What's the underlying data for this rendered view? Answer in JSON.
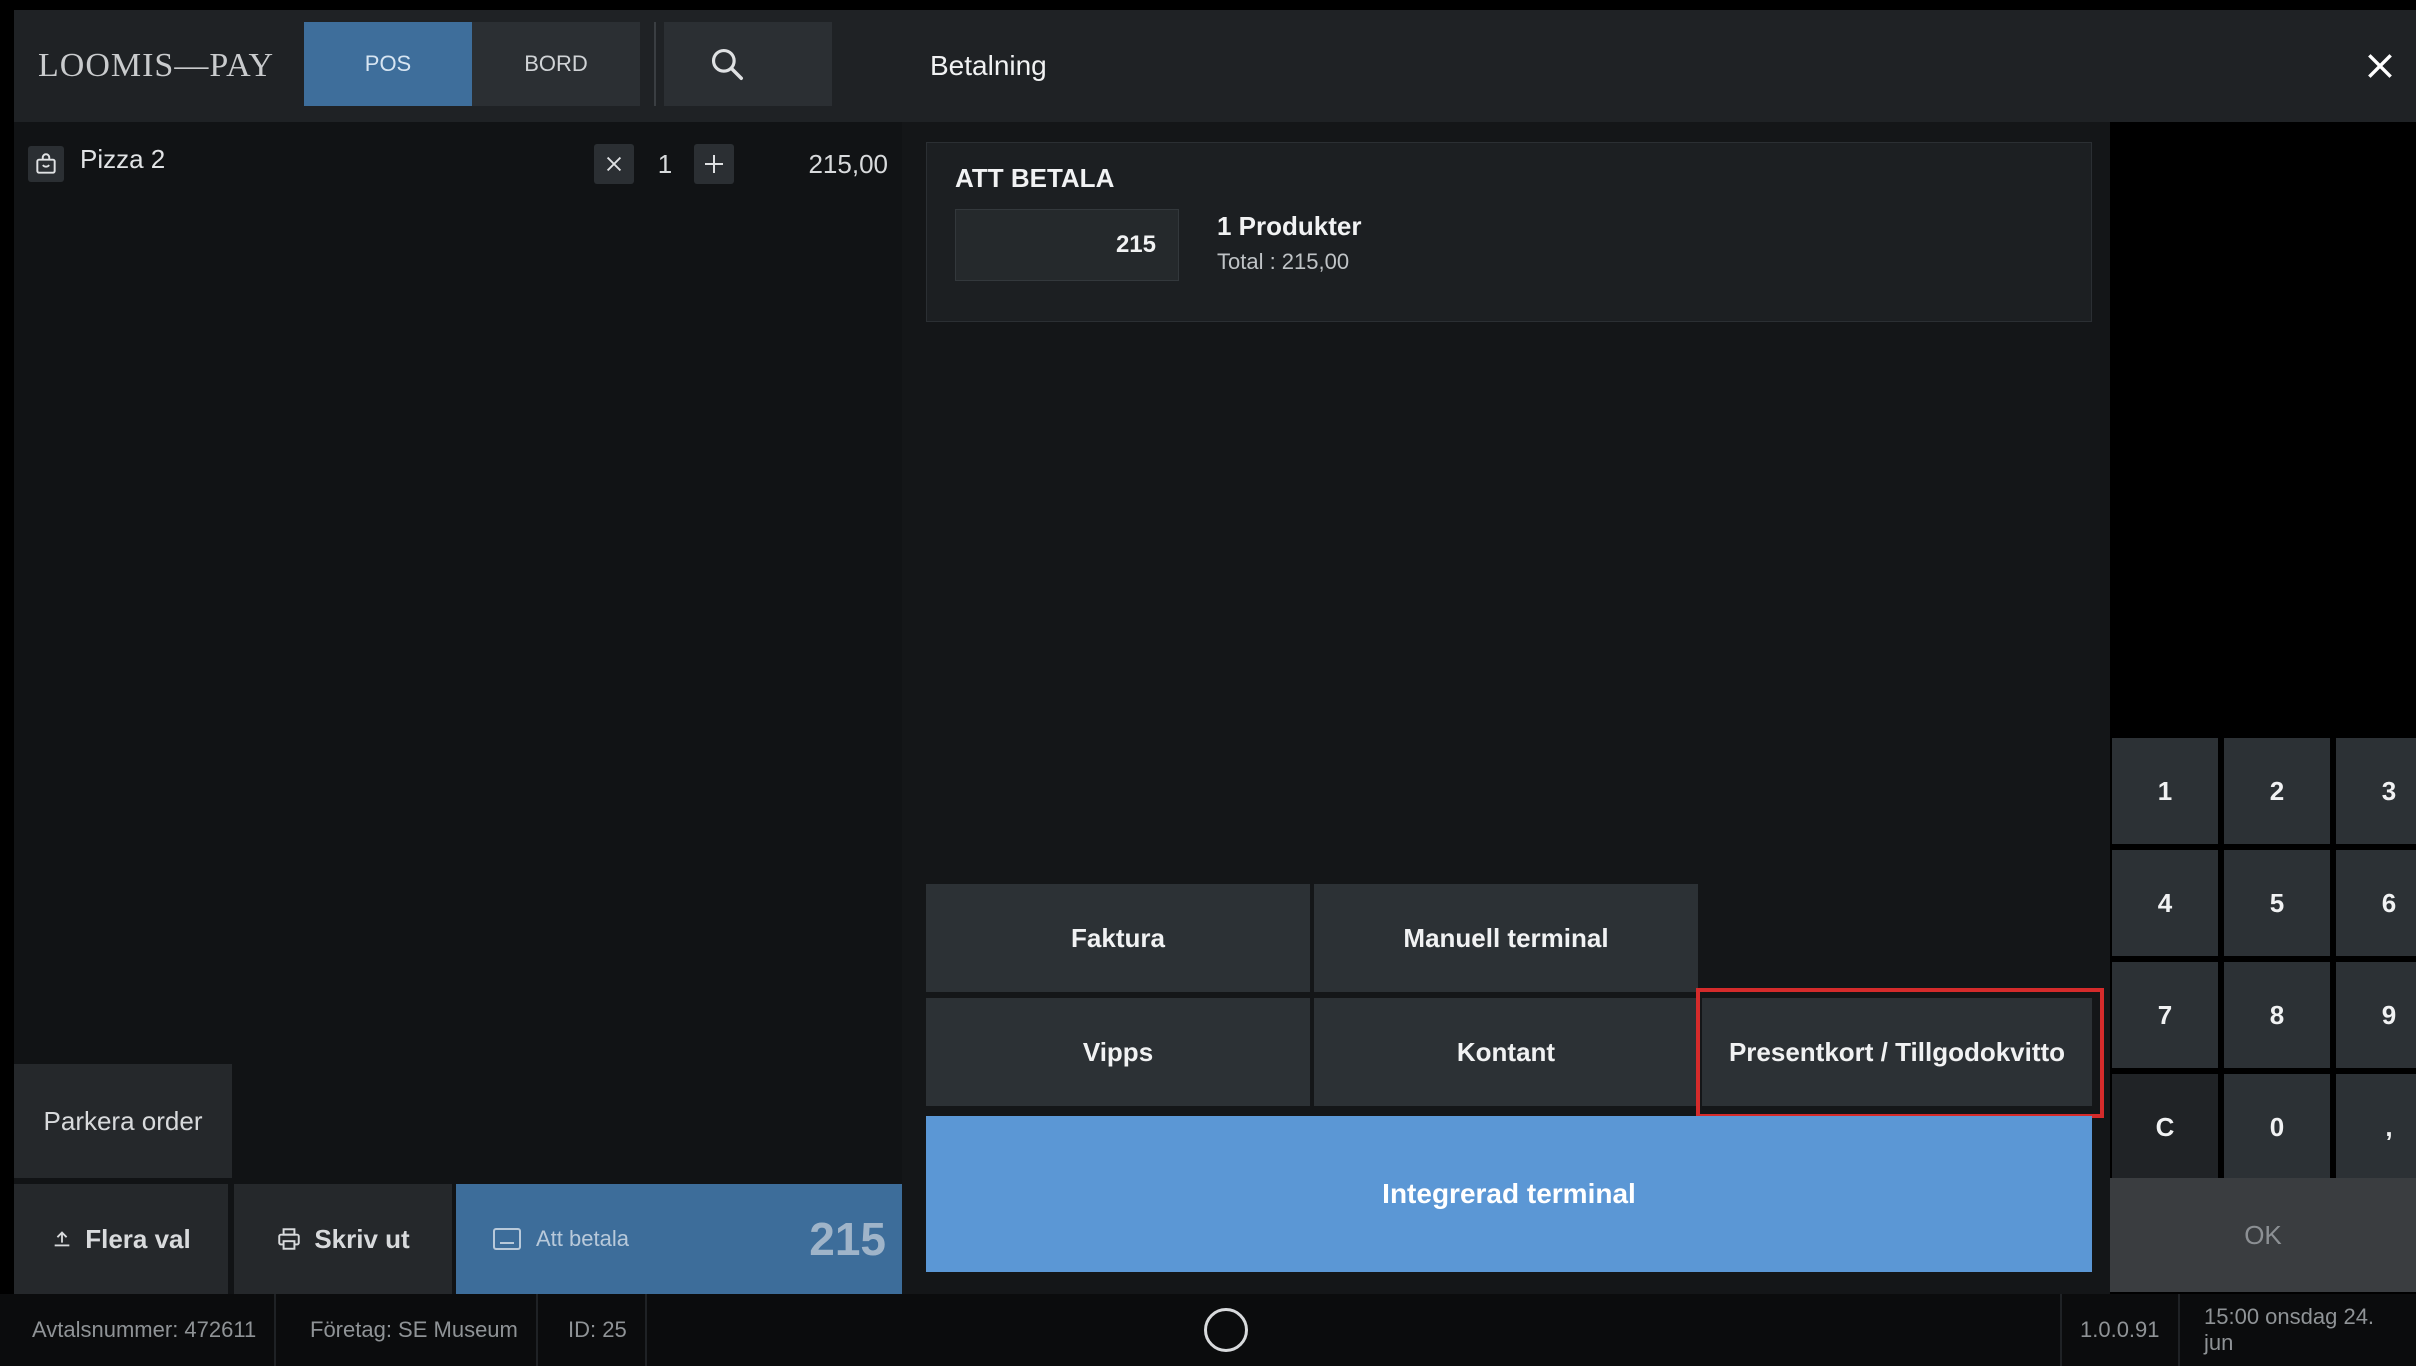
{
  "header": {
    "logo": "LOOMIS—PAY",
    "tabs": [
      {
        "label": "POS",
        "active": true
      },
      {
        "label": "BORD",
        "active": false
      }
    ]
  },
  "order": {
    "items": [
      {
        "name": "Pizza 2",
        "quantity": "1",
        "price": "215,00"
      }
    ],
    "park_label": "Parkera order",
    "flera_label": "Flera val",
    "skriv_label": "Skriv ut",
    "att_betala_label": "Att betala",
    "att_betala_amount": "215"
  },
  "payment": {
    "title": "Betalning",
    "summary_title": "ATT BETALA",
    "amount_value": "215",
    "product_count": "1 Produkter",
    "total_text": "Total : 215,00",
    "methods": {
      "faktura": "Faktura",
      "manuell": "Manuell terminal",
      "vipps": "Vipps",
      "kontant": "Kontant",
      "presentkort": "Presentkort / Tillgodokvitto",
      "integrerad": "Integrerad terminal"
    }
  },
  "keypad": {
    "keys": [
      "1",
      "2",
      "3",
      "4",
      "5",
      "6",
      "7",
      "8",
      "9",
      "C",
      "0",
      ","
    ],
    "ok_label": "OK"
  },
  "status": {
    "avtalsnummer": "Avtalsnummer: 472611",
    "foretag": "Företag: SE Museum",
    "id": "ID: 25",
    "version": "1.0.0.91",
    "datetime": "15:00 onsdag 24. jun"
  },
  "colors": {
    "accent": "#5b97d5",
    "active_tab": "#3e6e9b",
    "highlight": "#d52b2b"
  },
  "icons": {
    "search": "search-icon",
    "close": "close-icon",
    "order_item": "bag-icon",
    "remove": "x-icon",
    "add": "plus-icon",
    "flera": "upload-icon",
    "print": "printer-icon",
    "pay": "card-icon",
    "home": "home-circle-icon"
  }
}
